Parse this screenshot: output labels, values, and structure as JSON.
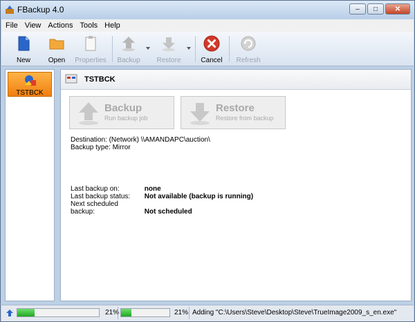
{
  "window": {
    "title": "FBackup 4.0"
  },
  "menu": [
    "File",
    "View",
    "Actions",
    "Tools",
    "Help"
  ],
  "toolbar": {
    "new": "New",
    "open": "Open",
    "properties": "Properties",
    "backup": "Backup",
    "restore": "Restore",
    "cancel": "Cancel",
    "refresh": "Refresh"
  },
  "jobs": [
    {
      "name": "TSTBCK"
    }
  ],
  "job": {
    "name": "TSTBCK",
    "backup_title": "Backup",
    "backup_sub": "Run backup job",
    "restore_title": "Restore",
    "restore_sub": "Restore from backup",
    "destination": "Destination: (Network) \\\\AMANDAPC\\auction\\",
    "backup_type": "Backup type: Mirror",
    "last_backup_on_label": "Last backup on:",
    "last_backup_on_value": "none",
    "last_status_label": "Last backup status:",
    "last_status_value": "Not available (backup is running)",
    "next_label": "Next scheduled backup:",
    "next_value": "Not scheduled"
  },
  "status": {
    "progress1_pct": 21,
    "progress1_text": "21%",
    "progress2_pct": 21,
    "progress2_text": "21%",
    "message": "Adding \"C:\\Users\\Steve\\Desktop\\Steve\\TrueImage2009_s_en.exe\""
  },
  "colors": {
    "accent_orange": "#f07f10",
    "progress_green": "#1fa61f",
    "cancel_red": "#d23a2a"
  }
}
